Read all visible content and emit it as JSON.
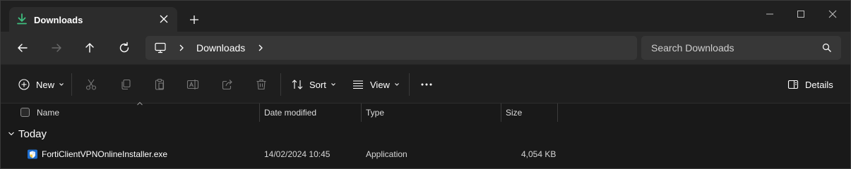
{
  "tab": {
    "title": "Downloads"
  },
  "navbar": {
    "breadcrumb": "Downloads",
    "search_placeholder": "Search Downloads"
  },
  "commandbar": {
    "new_label": "New",
    "sort_label": "Sort",
    "view_label": "View",
    "details_label": "Details"
  },
  "columns": {
    "name": "Name",
    "date_modified": "Date modified",
    "type": "Type",
    "size": "Size"
  },
  "group": {
    "label": "Today"
  },
  "files": [
    {
      "name": "FortiClientVPNOnlineInstaller.exe",
      "date_modified": "14/02/2024 10:45",
      "type": "Application",
      "size": "4,054 KB"
    }
  ],
  "colors": {
    "accent_green": "#3fbf7f",
    "window_bg": "#191919",
    "nav_bg": "#2c2c2c",
    "field_bg": "#373737"
  },
  "icons": {
    "tab_icon": "download-icon",
    "file_icon": "installer-shield-icon"
  }
}
